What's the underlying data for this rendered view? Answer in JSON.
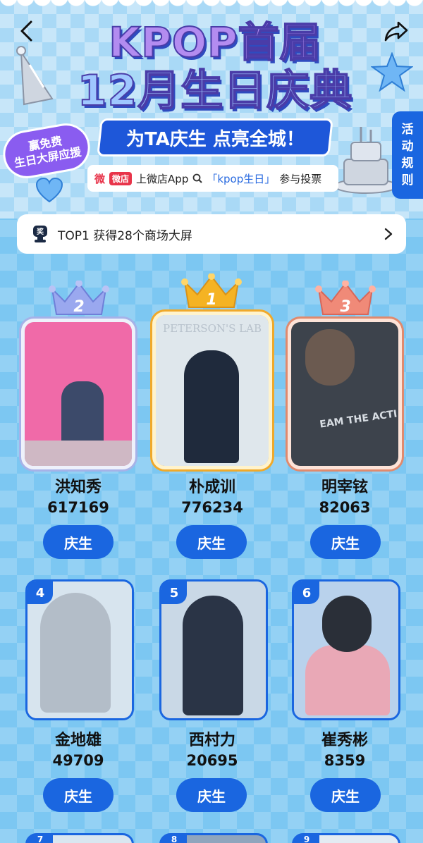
{
  "header": {
    "title_line1": "KPOP首届",
    "title_line2": "12月生日庆典",
    "subtitle": "为TA庆生 点亮全城！",
    "badge_line1": "赢免费",
    "badge_line2": "生日大屏应援",
    "info_logo": "微店",
    "info_prefix": "上微店App",
    "info_keyword": "「kpop生日」",
    "info_suffix": "参与投票",
    "rules_tab": [
      "活",
      "动",
      "规",
      "则"
    ]
  },
  "prize": {
    "icon_label": "奖",
    "text": "TOP1 获得28个商场大屏"
  },
  "button_label": "庆生",
  "ranking": [
    {
      "rank": "2",
      "name": "洪知秀",
      "votes": "617169",
      "photo_color": "#f06aa8"
    },
    {
      "rank": "1",
      "name": "朴成训",
      "votes": "776234",
      "photo_color": "#dfe7ec"
    },
    {
      "rank": "3",
      "name": "明宰铉",
      "votes": "82063",
      "photo_color": "#3d434c"
    },
    {
      "rank": "4",
      "name": "金地雄",
      "votes": "49709",
      "photo_color": "#d7e4ee"
    },
    {
      "rank": "5",
      "name": "西村力",
      "votes": "20695",
      "photo_color": "#c9d8e6"
    },
    {
      "rank": "6",
      "name": "崔秀彬",
      "votes": "8359",
      "photo_color": "#b9d2ec"
    }
  ],
  "partial_ranks": [
    "7",
    "8",
    "9"
  ],
  "colors": {
    "accent": "#1a66e0",
    "gold_crown": "#f5b323",
    "silver_crown": "#9aa8ef",
    "bronze_crown": "#f08a78"
  }
}
